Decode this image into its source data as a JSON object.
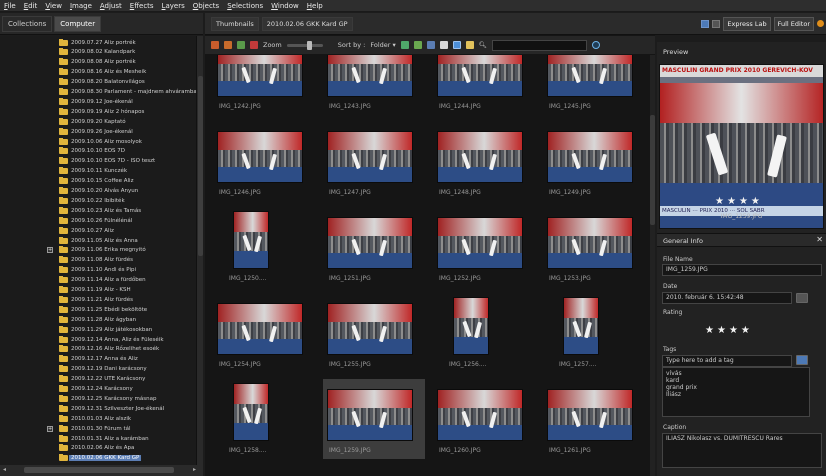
{
  "menu": [
    "File",
    "Edit",
    "View",
    "Image",
    "Adjust",
    "Effects",
    "Layers",
    "Objects",
    "Selections",
    "Window",
    "Help"
  ],
  "left_tabs": [
    "Collections",
    "Computer"
  ],
  "tree": [
    {
      "label": "2009.07.27 Aliz portrék",
      "exp": ""
    },
    {
      "label": "2009.08.02 Kalandpark",
      "exp": ""
    },
    {
      "label": "2009.08.08 Aliz portrék",
      "exp": ""
    },
    {
      "label": "2009.08.16 Aliz és Mesheik",
      "exp": ""
    },
    {
      "label": "2009.08.20 Balatonvilágos",
      "exp": ""
    },
    {
      "label": "2009.08.30 Parlament - majdnem ahváramban",
      "exp": ""
    },
    {
      "label": "2009.09.12 Joe-ékenál",
      "exp": ""
    },
    {
      "label": "2009.09.19 Aliz 2 hónapos",
      "exp": ""
    },
    {
      "label": "2009.09.20 Kaptató",
      "exp": ""
    },
    {
      "label": "2009.09.26 Joe-ékenál",
      "exp": ""
    },
    {
      "label": "2009.10.06 Aliz mosolyok",
      "exp": ""
    },
    {
      "label": "2009.10.10 EOS 7D",
      "exp": ""
    },
    {
      "label": "2009.10.10 EOS 7D - ISO teszt",
      "exp": ""
    },
    {
      "label": "2009.10.11 Kunczék",
      "exp": ""
    },
    {
      "label": "2009.10.15 Coffee Aliz",
      "exp": ""
    },
    {
      "label": "2009.10.20 Alvás Anyun",
      "exp": ""
    },
    {
      "label": "2009.10.22 Ibibiték",
      "exp": ""
    },
    {
      "label": "2009.10.23 Aliz és Tamás",
      "exp": ""
    },
    {
      "label": "2009.10.26 Fülnélénál",
      "exp": ""
    },
    {
      "label": "2009.10.27 Aliz",
      "exp": ""
    },
    {
      "label": "2009.11.05 Aliz és Anna",
      "exp": ""
    },
    {
      "label": "2009.11.06 Erika megnyitó",
      "exp": "+"
    },
    {
      "label": "2009.11.08 Aliz fürdés",
      "exp": ""
    },
    {
      "label": "2009.11.10 Andi és Pipi",
      "exp": ""
    },
    {
      "label": "2009.11.14 Aliz a fürdőben",
      "exp": ""
    },
    {
      "label": "2009.11.19 Aliz - KSH",
      "exp": ""
    },
    {
      "label": "2009.11.21 Aliz fürdés",
      "exp": ""
    },
    {
      "label": "2009.11.25 Ebédi beköltöte",
      "exp": ""
    },
    {
      "label": "2009.11.28 Aliz ágyban",
      "exp": ""
    },
    {
      "label": "2009.11.29 Aliz játékosokban",
      "exp": ""
    },
    {
      "label": "2009.12.14 Anna, Aliz és Füleséik",
      "exp": ""
    },
    {
      "label": "2009.12.16 Aliz Rőzelihet esoék",
      "exp": ""
    },
    {
      "label": "2009.12.17 Anna és Aliz",
      "exp": ""
    },
    {
      "label": "2009.12.19 Dani karácsony",
      "exp": ""
    },
    {
      "label": "2009.12.22 UTE Karácsony",
      "exp": ""
    },
    {
      "label": "2009.12.24 Karácsony",
      "exp": ""
    },
    {
      "label": "2009.12.25 Karácsony másnap",
      "exp": ""
    },
    {
      "label": "2009.12.31 Szilveszter Joe-ékenál",
      "exp": ""
    },
    {
      "label": "2010.01.03 Aliz alszik",
      "exp": ""
    },
    {
      "label": "2010.01.30 Fürum tál",
      "exp": "+"
    },
    {
      "label": "2010.01.31 Aliz a karámban",
      "exp": ""
    },
    {
      "label": "2010.02.06 Aliz és Apa",
      "exp": ""
    },
    {
      "label": "2010.02.06 GKK Kard GP",
      "exp": "",
      "selected": true
    }
  ],
  "breadcrumb": [
    "Thumbnails",
    "2010.02.06 GKK Kard GP"
  ],
  "toolbar": {
    "zoom": "Zoom",
    "sort": "Sort by :",
    "sort_value": "Folder ▾"
  },
  "modes": [
    "Express Lab",
    "Full Editor"
  ],
  "thumbnails": [
    {
      "name": "IMG_1242.JPG",
      "portrait": false
    },
    {
      "name": "IMG_1243.JPG",
      "portrait": false
    },
    {
      "name": "IMG_1244.JPG",
      "portrait": false
    },
    {
      "name": "IMG_1245.JPG",
      "portrait": false
    },
    {
      "name": "IMG_1246.JPG",
      "portrait": false
    },
    {
      "name": "IMG_1247.JPG",
      "portrait": false
    },
    {
      "name": "IMG_1248.JPG",
      "portrait": false
    },
    {
      "name": "IMG_1249.JPG",
      "portrait": false
    },
    {
      "name": "IMG_1250....",
      "portrait": true
    },
    {
      "name": "IMG_1251.JPG",
      "portrait": false
    },
    {
      "name": "IMG_1252.JPG",
      "portrait": false
    },
    {
      "name": "IMG_1253.JPG",
      "portrait": false
    },
    {
      "name": "IMG_1254.JPG",
      "portrait": false
    },
    {
      "name": "IMG_1255.JPG",
      "portrait": false
    },
    {
      "name": "IMG_1256....",
      "portrait": true
    },
    {
      "name": "IMG_1257....",
      "portrait": true
    },
    {
      "name": "IMG_1258....",
      "portrait": true
    },
    {
      "name": "IMG_1259.JPG",
      "portrait": false,
      "selected": true
    },
    {
      "name": "IMG_1260.JPG",
      "portrait": false
    },
    {
      "name": "IMG_1261.JPG",
      "portrait": false
    }
  ],
  "preview": {
    "title": "Preview",
    "banner": "MASCULIN GRAND PRIX 2010 GEREVICH-KOV",
    "bottom_banner": "MASCULIN ⋯ PRIX 2010 ⋯ SOL SABR",
    "rating": 4,
    "filename": "IMG_1259.JPG"
  },
  "info": {
    "title": "General Info",
    "file_name_label": "File Name",
    "file_name": "IMG_1259.JPG",
    "date_label": "Date",
    "date": "2010. február 6. 15:42:48",
    "rating_label": "Rating",
    "rating": 4,
    "tags_label": "Tags",
    "tags_placeholder": "Type here to add a tag",
    "tags": [
      "vívás",
      "kard",
      "grand prix",
      "Iliász"
    ],
    "caption_label": "Caption",
    "caption": "ILIASZ Nikolasz vs. DUMITRESCU Rares"
  },
  "colors": {
    "accent": "#5b7db3",
    "folder": "#e0b43c",
    "status": "#e08e1b"
  }
}
